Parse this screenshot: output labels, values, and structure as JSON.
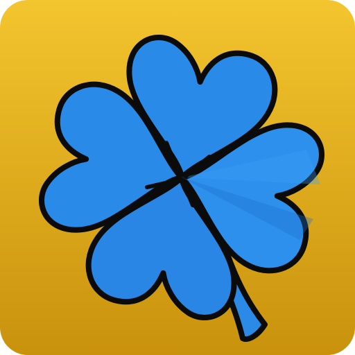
{
  "icon": {
    "name": "four-leaf-clover-icon",
    "colors": {
      "background_top": "#F3C52E",
      "background_bottom": "#C9920D",
      "leaf_primary": "#2A8AE8",
      "leaf_light": "#3EA0F5",
      "leaf_shadow": "#1F6FCB",
      "outline": "#0B0B0B",
      "stem": "#2B8AE6"
    }
  }
}
